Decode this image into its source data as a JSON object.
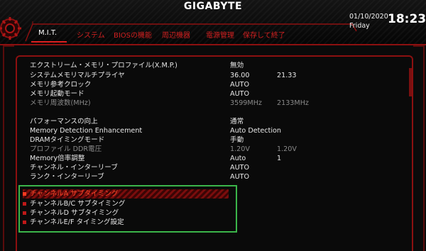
{
  "brand": "GIGABYTE",
  "clock": {
    "date": "01/10/2020",
    "day": "Friday",
    "time": "18:23"
  },
  "tabs": [
    {
      "label": "M.I.T.",
      "active": true
    },
    {
      "label": "システム",
      "active": false
    },
    {
      "label": "BIOSの機能",
      "active": false
    },
    {
      "label": "周辺機器",
      "active": false
    },
    {
      "label": "電源管理",
      "active": false
    },
    {
      "label": "保存して終了",
      "active": false
    }
  ],
  "settings": [
    {
      "label": "エクストリーム・メモリ・プロファイル(X.M.P.)",
      "v1": "無効",
      "v2": ""
    },
    {
      "label": "システムメモリマルチプライヤ",
      "v1": "36.00",
      "v2": "21.33"
    },
    {
      "label": "メモリ参考クロック",
      "v1": "AUTO",
      "v2": ""
    },
    {
      "label": "メモリ起動モード",
      "v1": "AUTO",
      "v2": ""
    },
    {
      "label": "メモリ周波数(MHz)",
      "v1": "3599MHz",
      "v2": "2133MHz",
      "dim": true
    },
    {
      "label": "パフォーマンスの向上",
      "v1": "通常",
      "v2": ""
    },
    {
      "label": "Memory Detection Enhancement",
      "v1": "Auto Detection",
      "v2": ""
    },
    {
      "label": "DRAMタイミングモード",
      "v1": "手動",
      "v2": ""
    },
    {
      "label": "プロファイル DDR電圧",
      "v1": "1.20V",
      "v2": "1.20V",
      "dim": true
    },
    {
      "label": "Memory倍率調整",
      "v1": "Auto",
      "v2": "1"
    },
    {
      "label": "チャンネル・インターリーブ",
      "v1": "AUTO",
      "v2": ""
    },
    {
      "label": "ランク・インターリーブ",
      "v1": "AUTO",
      "v2": ""
    }
  ],
  "submenus": [
    {
      "label": "チャンネルA サブタイミング",
      "selected": true
    },
    {
      "label": "チャンネルB/C サブタイミング",
      "selected": false
    },
    {
      "label": "チャンネルD サブタイミング",
      "selected": false
    },
    {
      "label": "チャンネルE/F タイミング設定",
      "selected": false
    }
  ],
  "colors": {
    "accent": "#e02020",
    "highlight_box": "#3bb54a",
    "background": "#0a0a0a"
  }
}
